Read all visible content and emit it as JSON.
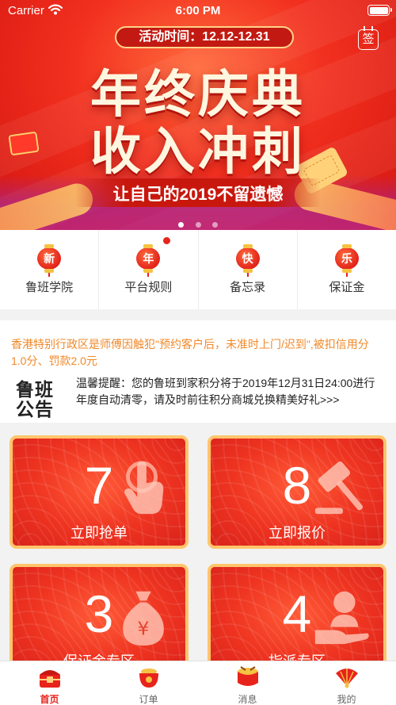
{
  "status_bar": {
    "carrier": "Carrier",
    "time": "6:00 PM"
  },
  "banner": {
    "event_time": "活动时间：12.12-12.31",
    "headline_1": "年终庆典",
    "headline_2": "收入冲刺",
    "slogan": "让自己的2019不留遗憾",
    "checkin_label": "签",
    "slides": 3,
    "active_slide": 0
  },
  "quick_menu": [
    {
      "badge": "新",
      "label": "鲁班学院"
    },
    {
      "badge": "年",
      "label": "平台规则",
      "has_red_dot": true
    },
    {
      "badge": "快",
      "label": "备忘录"
    },
    {
      "badge": "乐",
      "label": "保证金"
    }
  ],
  "notice": {
    "marquee": "香港特别行政区是师傅因触犯\"预约客户后，未准时上门/迟到\",被扣信用分1.0分、罚款2.0元",
    "logo_line_1": "鲁班",
    "logo_line_2": "公告",
    "text": "温馨提醒：您的鲁班到家积分将于2019年12月31日24:00进行年度自动清零，请及时前往积分商城兑换精美好礼>>>"
  },
  "cards": [
    {
      "count": "7",
      "label": "立即抢单",
      "icon": "hand-tap-icon"
    },
    {
      "count": "8",
      "label": "立即报价",
      "icon": "gavel-icon"
    },
    {
      "count": "3",
      "label": "保证金专区",
      "icon": "money-bag-icon"
    },
    {
      "count": "4",
      "label": "指派专区",
      "icon": "person-hand-icon"
    }
  ],
  "tabbar": {
    "items": [
      {
        "label": "首页",
        "icon": "home-chest-icon",
        "active": true
      },
      {
        "label": "订单",
        "icon": "coin-pot-icon"
      },
      {
        "label": "消息",
        "icon": "drum-icon"
      },
      {
        "label": "我的",
        "icon": "fan-icon"
      }
    ]
  },
  "colors": {
    "primary_red": "#e8231c",
    "notice_orange": "#f0892a",
    "gold": "#ffc56b"
  }
}
